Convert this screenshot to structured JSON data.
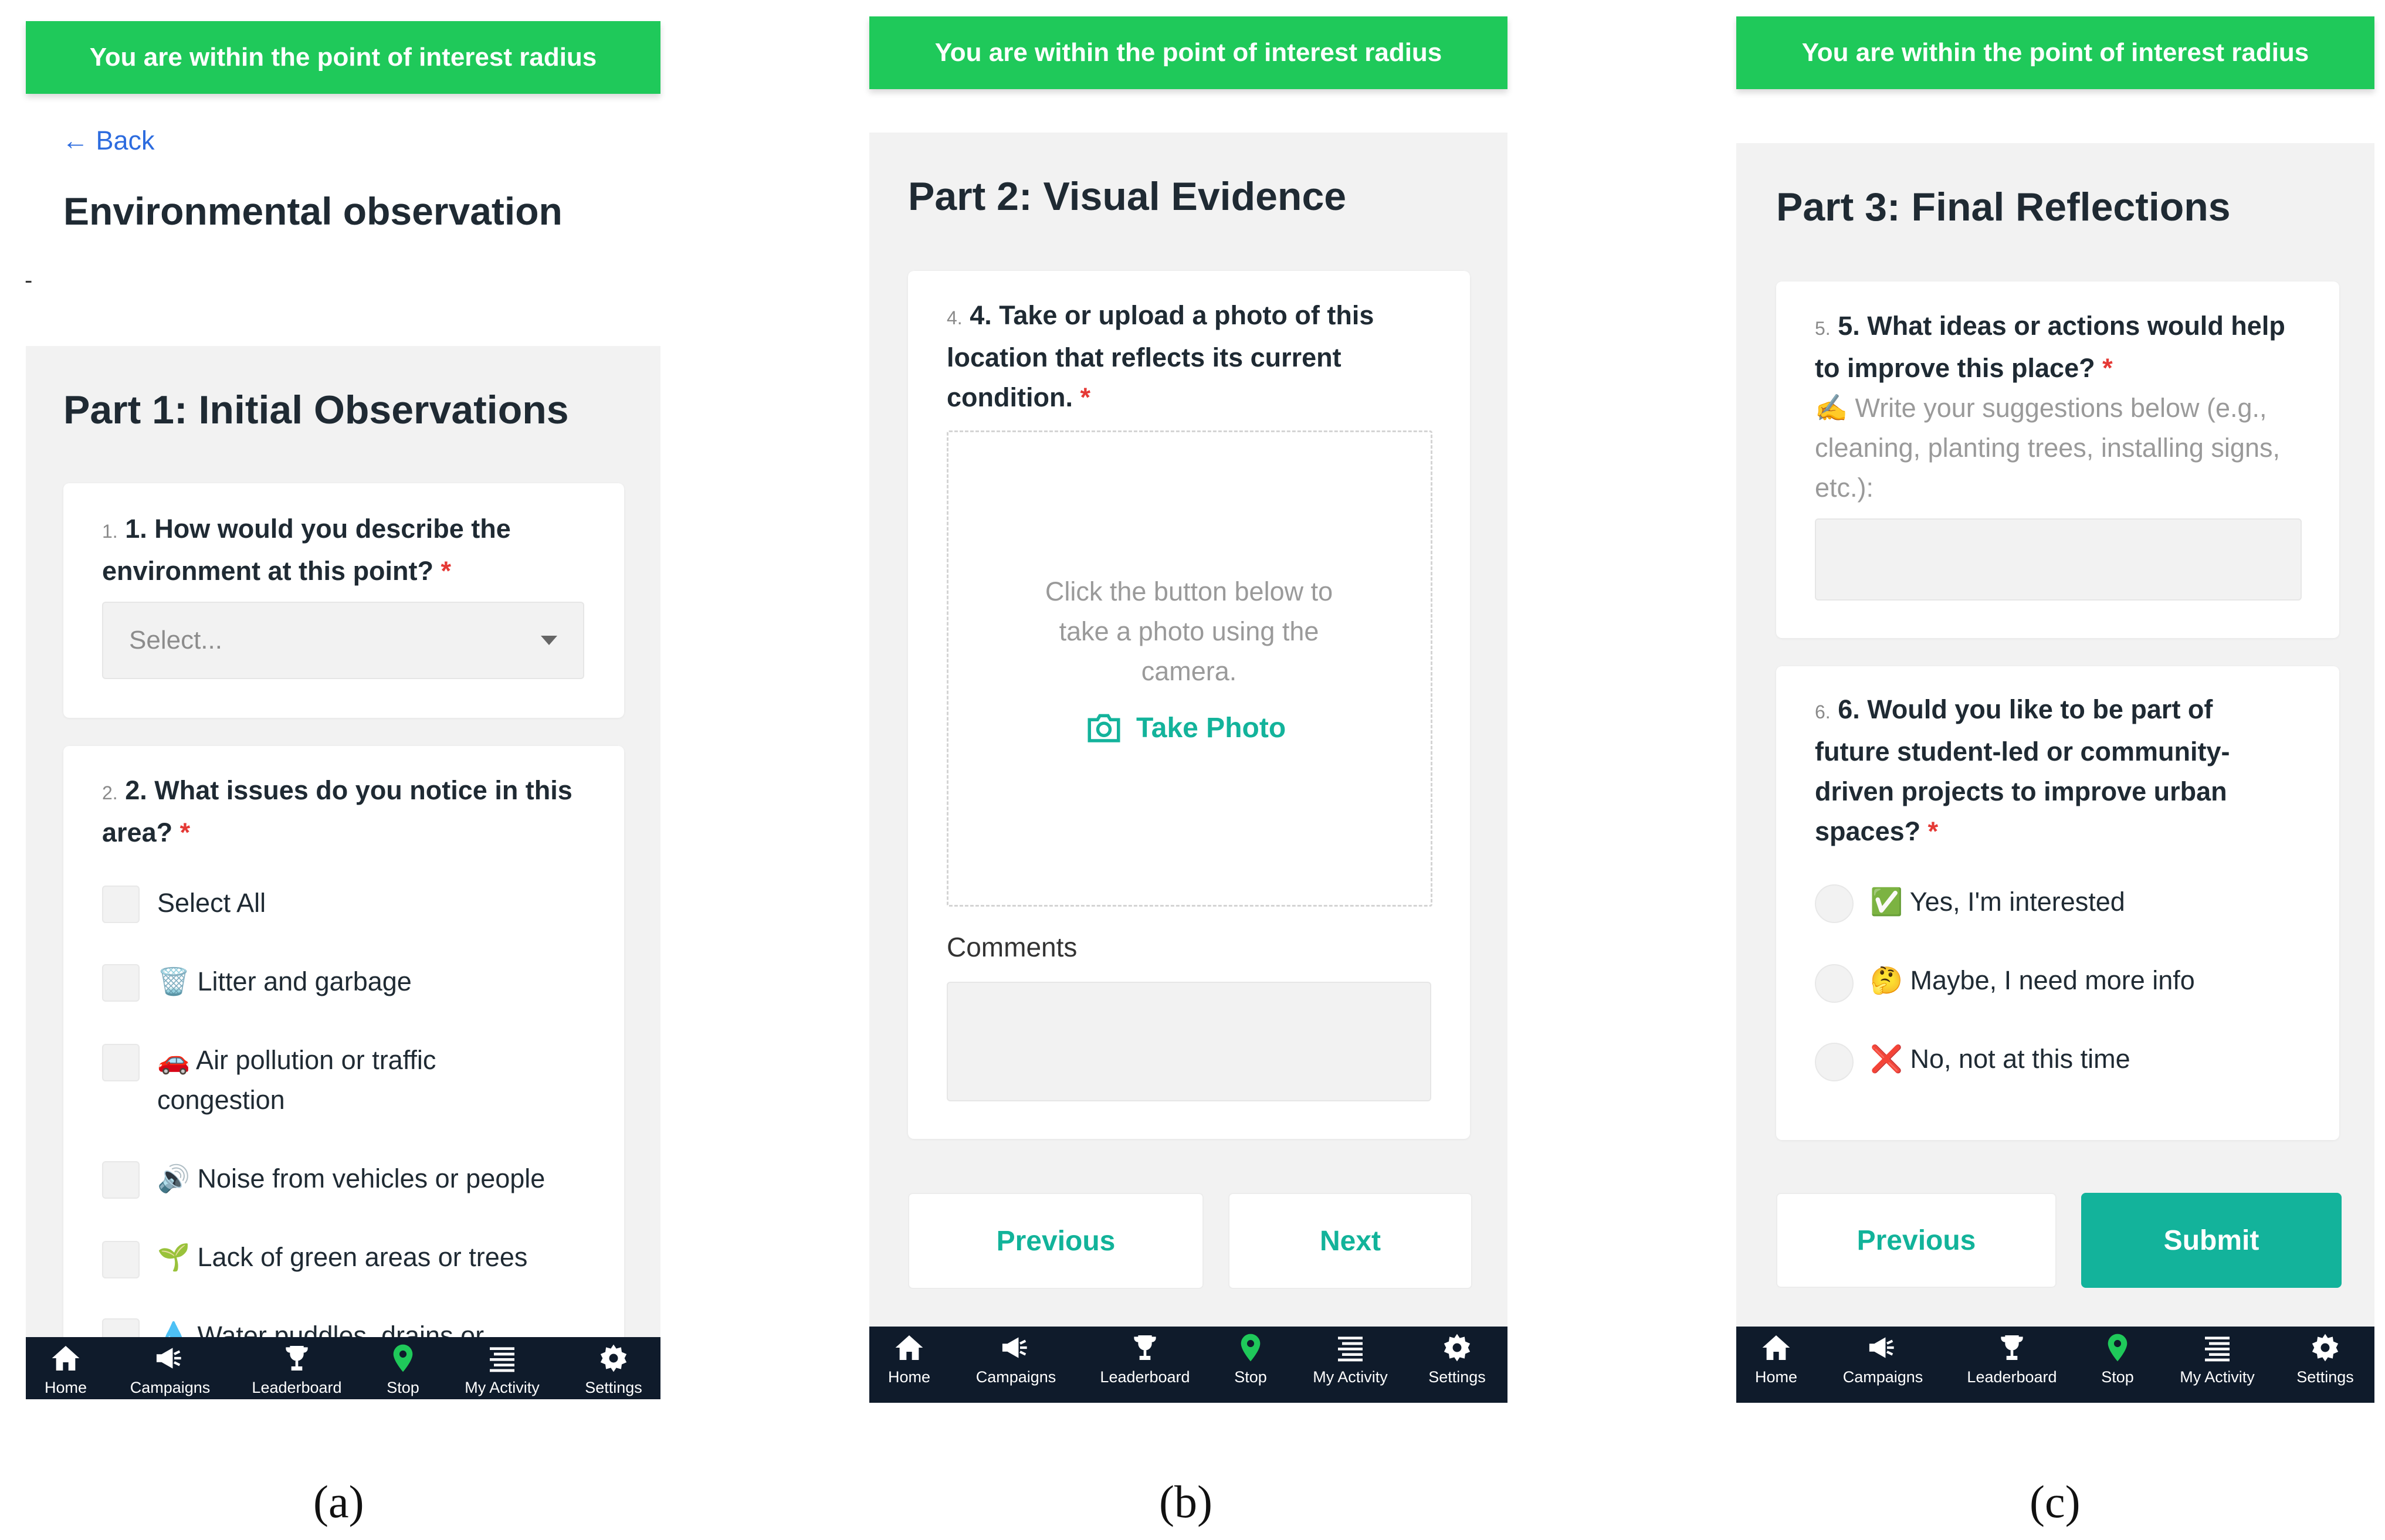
{
  "banner_text": "You are within the point of interest radius",
  "nav_items": [
    {
      "label": "Home",
      "icon": "home-icon"
    },
    {
      "label": "Campaigns",
      "icon": "megaphone-icon"
    },
    {
      "label": "Leaderboard",
      "icon": "trophy-icon"
    },
    {
      "label": "Stop",
      "icon": "location-pin-icon",
      "active_color": "#1fc95a"
    },
    {
      "label": "My Activity",
      "icon": "list-icon"
    },
    {
      "label": "Settings",
      "icon": "gear-icon"
    }
  ],
  "colors": {
    "banner": "#1fc95a",
    "accent": "#13b39b",
    "navbar": "#0f1b2b",
    "required": "#e53935",
    "link": "#2d6cdf"
  },
  "panel_a": {
    "caption": "(a)",
    "back_label": "← Back",
    "page_title": "Environmental observation",
    "dash": "-",
    "part_title": "Part 1: Initial Observations",
    "q1": {
      "num": "1.",
      "text": "1. How would you describe the environment at this point?",
      "required": "*",
      "placeholder": "Select..."
    },
    "q2": {
      "num": "2.",
      "text": "2. What issues do you notice in this area?",
      "required": "*",
      "options": [
        {
          "label": "Select All"
        },
        {
          "label": "🗑️ Litter and garbage"
        },
        {
          "label": "🚗 Air pollution or traffic congestion"
        },
        {
          "label": "🔊 Noise from vehicles or people"
        },
        {
          "label": "🌱 Lack of green areas or trees"
        },
        {
          "label": "💧 Water puddles, drains or"
        }
      ]
    }
  },
  "panel_b": {
    "caption": "(b)",
    "part_title": "Part 2: Visual Evidence",
    "q4": {
      "num": "4.",
      "text": "4. Take or upload a photo of this location that reflects its current condition.",
      "required": "*"
    },
    "photo_hint": "Click the button below to take a photo using the camera.",
    "take_photo_label": "Take Photo",
    "comments_label": "Comments",
    "previous_label": "Previous",
    "next_label": "Next"
  },
  "panel_c": {
    "caption": "(c)",
    "part_title": "Part 3: Final Reflections",
    "q5": {
      "num": "5.",
      "text": "5. What ideas or actions would help to improve this place?",
      "required": "*",
      "hint": "✍️ Write your suggestions below (e.g., cleaning, planting trees, installing signs, etc.):"
    },
    "q6": {
      "num": "6.",
      "text": "6. Would you like to be part of future student-led or community-driven projects to improve urban spaces?",
      "required": "*",
      "options": [
        {
          "label": "✅ Yes, I'm interested"
        },
        {
          "label": "🤔 Maybe, I need more info"
        },
        {
          "label": "❌ No, not at this time"
        }
      ]
    },
    "previous_label": "Previous",
    "submit_label": "Submit"
  }
}
